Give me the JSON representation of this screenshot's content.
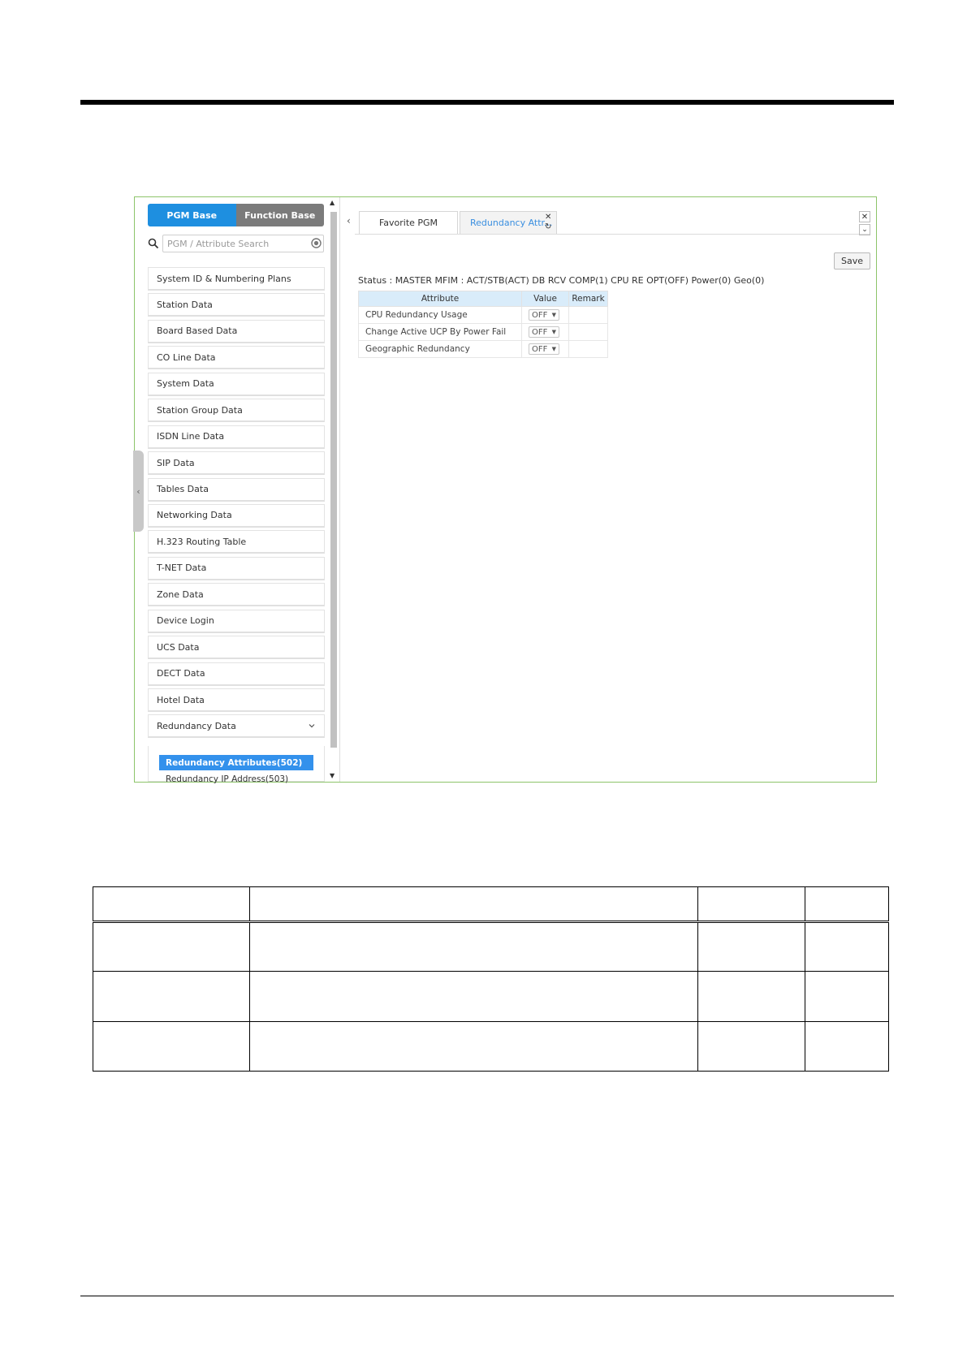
{
  "sidebar": {
    "mode_buttons": [
      "PGM Base",
      "Function Base"
    ],
    "search": {
      "placeholder": "PGM / Attribute Search",
      "value": ""
    },
    "menu_items": [
      "System ID & Numbering Plans",
      "Station Data",
      "Board Based Data",
      "CO Line Data",
      "System Data",
      "Station Group Data",
      "ISDN Line Data",
      "SIP Data",
      "Tables Data",
      "Networking Data",
      "H.323 Routing Table",
      "T-NET Data",
      "Zone Data",
      "Device Login",
      "UCS Data",
      "DECT Data",
      "Hotel Data",
      "Redundancy Data"
    ],
    "submenu": {
      "active": "Redundancy Attributes(502)",
      "other": "Redundancy IP Address(503)"
    }
  },
  "tabs": {
    "favorite": "Favorite PGM",
    "current": "Redundancy Attr..."
  },
  "toolbar": {
    "save_label": "Save"
  },
  "status_text": "Status : MASTER MFIM : ACT/STB(ACT) DB RCV COMP(1) CPU RE OPT(OFF) Power(0) Geo(0)",
  "attribute_table": {
    "headers": [
      "Attribute",
      "Value",
      "Remark"
    ],
    "rows": [
      {
        "attribute": "CPU Redundancy Usage",
        "value": "OFF",
        "remark": ""
      },
      {
        "attribute": "Change Active UCP By Power Fail",
        "value": "OFF",
        "remark": ""
      },
      {
        "attribute": "Geographic Redundancy",
        "value": "OFF",
        "remark": ""
      }
    ]
  },
  "icons": {
    "search": "search-icon",
    "clear": "clear-icon",
    "close": "close-icon",
    "refresh": "refresh-icon",
    "chevron": "chevron-down-icon"
  },
  "colors": {
    "accent": "#1e8fe0",
    "frame_border": "#8dc46a",
    "table_header": "#d9ecfa"
  }
}
